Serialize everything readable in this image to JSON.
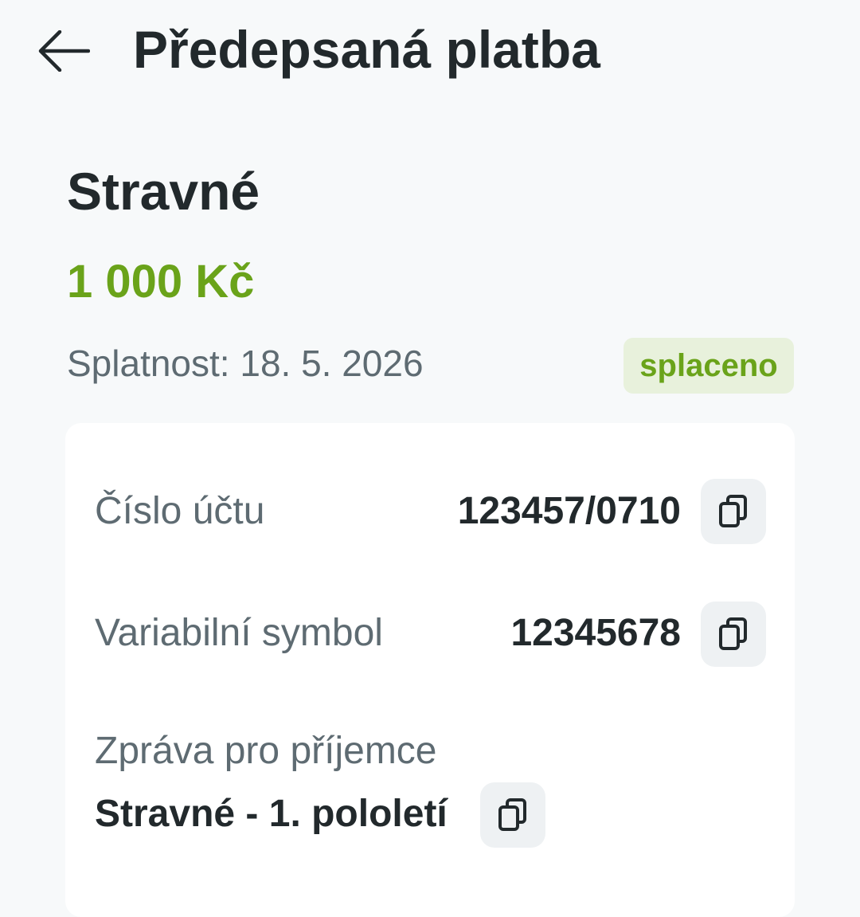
{
  "header": {
    "title": "Předepsaná platba"
  },
  "payment": {
    "name": "Stravné",
    "amount": "1 000 Kč",
    "due": "Splatnost: 18. 5. 2026",
    "status": "splaceno"
  },
  "details": {
    "account_label": "Číslo účtu",
    "account_value": "123457/0710",
    "vs_label": "Variabilní symbol",
    "vs_value": "12345678",
    "message_label": "Zpráva pro příjemce",
    "message_value": "Stravné - 1. pololetí"
  },
  "icons": {
    "back": "arrow-left-icon",
    "copy": "copy-icon"
  },
  "colors": {
    "background": "#f7f9fa",
    "accent_green": "#6aa31a",
    "badge_bg": "#e8f1dc",
    "text_primary": "#22292c",
    "text_secondary": "#5e6b72",
    "card_bg": "#ffffff",
    "button_bg": "#eef1f3"
  }
}
